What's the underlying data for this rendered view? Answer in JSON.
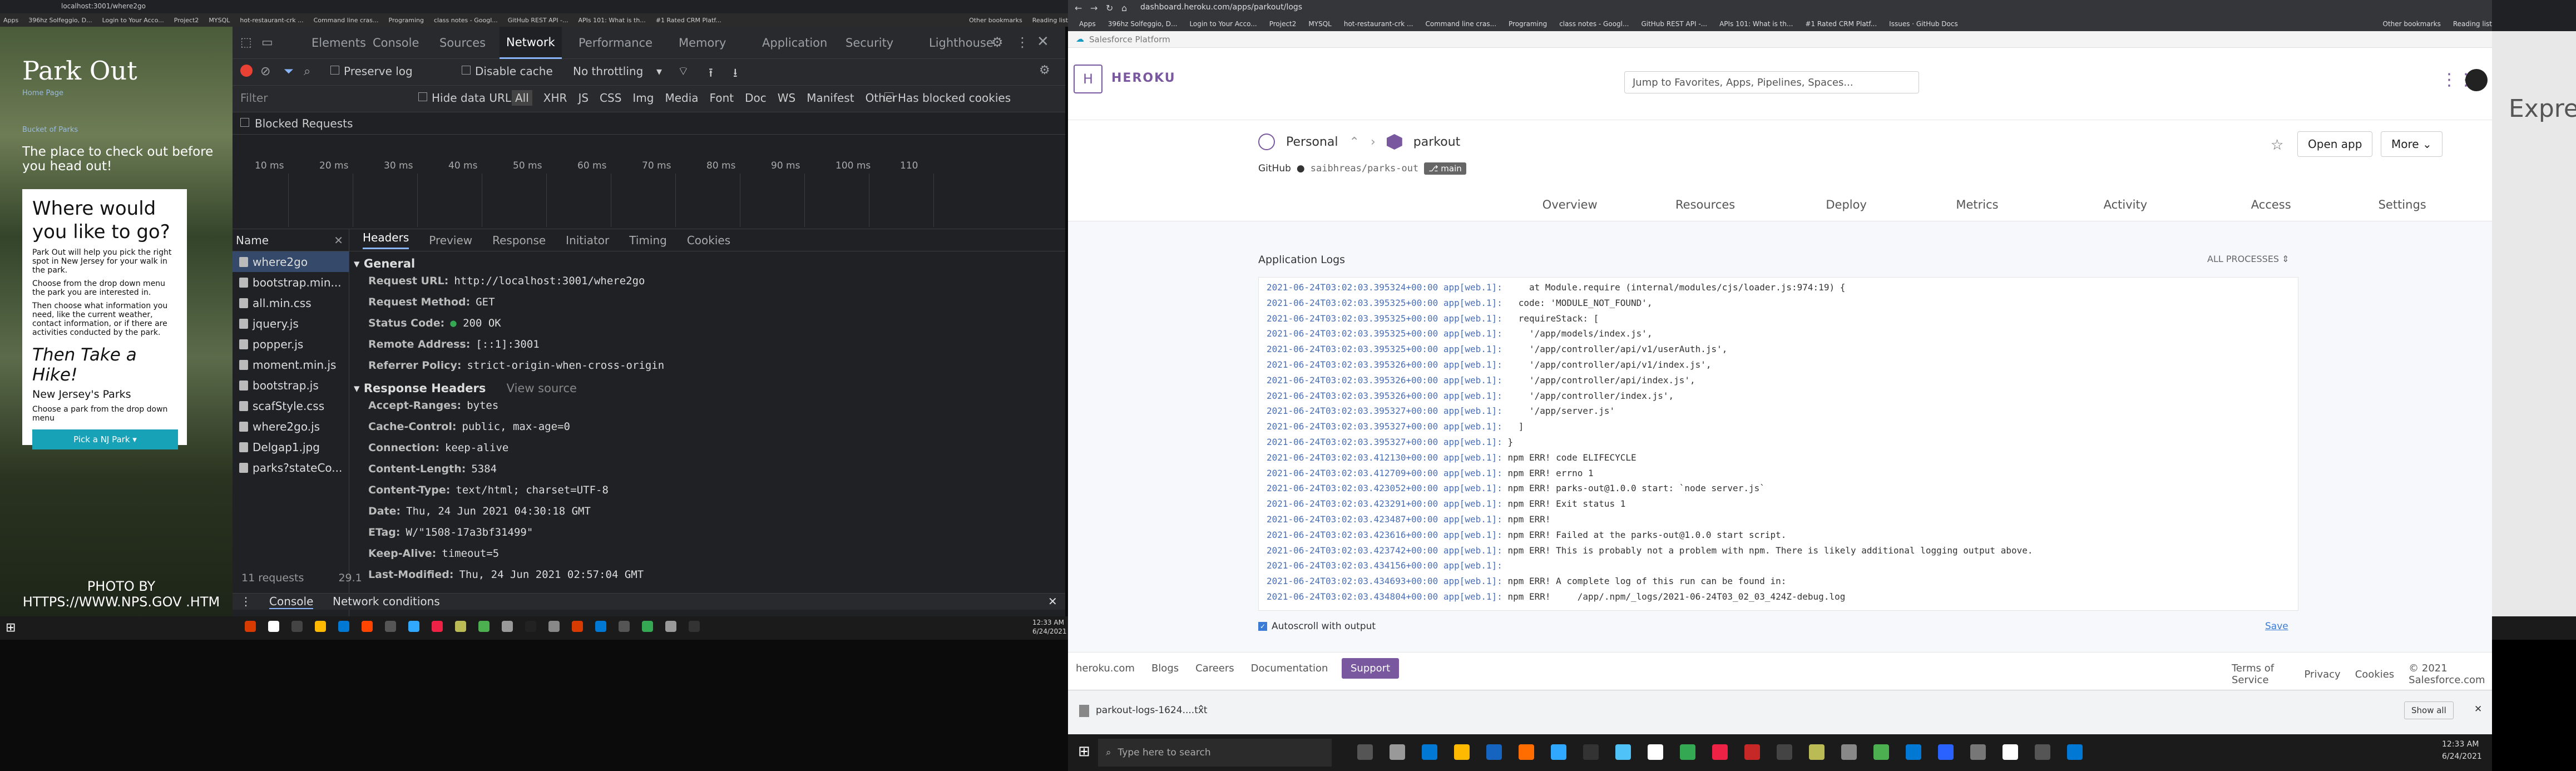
{
  "screen1": {
    "tab_url": "localhost:3001/where2go",
    "bookmarks": [
      "Apps",
      "396hz Solfeggio, D...",
      "Login to Your Acco...",
      "Project2",
      "MYSQL",
      "hot-restaurant-crk ...",
      "Command line cras...",
      "Programing",
      "class notes - Googl...",
      "GitHub REST API -...",
      "APIs 101: What is th...",
      "#1 Rated CRM Platf..."
    ],
    "bookmarks_right": [
      "Other bookmarks",
      "Reading list"
    ],
    "site": {
      "title": "Park Out",
      "link1": "Home Page",
      "link2": "Bucket of Parks",
      "tagline": "The place to check out before you head out!",
      "card_heading": "Where would you like to go?",
      "para1": "Park Out will help you pick the right spot in New Jersey for your walk in the park.",
      "para2": "Choose from the drop down menu the park you are interested in.",
      "para3": "Then choose what information you need, like the current weather, contact information, or if there are activities conducted by the park.",
      "hike": "Then Take a Hike!",
      "parks": "New Jersey's Parks",
      "choose": "Choose a park from the drop down menu",
      "button": "Pick a NJ Park",
      "photo_credit": "PHOTO BY HTTPS://WWW.NPS.GOV .HTM"
    },
    "devtools": {
      "tabs": [
        "Elements",
        "Console",
        "Sources",
        "Network",
        "Performance",
        "Memory",
        "Application",
        "Security",
        "Lighthouse"
      ],
      "active_tab": "Network",
      "preserve_log": "Preserve log",
      "disable_cache": "Disable cache",
      "throttling": "No throttling",
      "filter_placeholder": "Filter",
      "hide_data_urls": "Hide data URLs",
      "types": [
        "All",
        "XHR",
        "JS",
        "CSS",
        "Img",
        "Media",
        "Font",
        "Doc",
        "WS",
        "Manifest",
        "Other"
      ],
      "blocked_cookies": "Has blocked cookies",
      "blocked_requests": "Blocked Requests",
      "ticks": [
        "10 ms",
        "20 ms",
        "30 ms",
        "40 ms",
        "50 ms",
        "60 ms",
        "70 ms",
        "80 ms",
        "90 ms",
        "100 ms",
        "110"
      ],
      "name_header": "Name",
      "requests": [
        "where2go",
        "bootstrap.min...",
        "all.min.css",
        "jquery.js",
        "popper.js",
        "moment.min.js",
        "bootstrap.js",
        "scafStyle.css",
        "where2go.js",
        "Delgap1.jpg",
        "parks?stateCo..."
      ],
      "detail_tabs": [
        "Headers",
        "Preview",
        "Response",
        "Initiator",
        "Timing",
        "Cookies"
      ],
      "general_label": "General",
      "general": [
        {
          "k": "Request URL:",
          "v": "http://localhost:3001/where2go"
        },
        {
          "k": "Request Method:",
          "v": "GET"
        },
        {
          "k": "Status Code:",
          "v": "200 OK"
        },
        {
          "k": "Remote Address:",
          "v": "[::1]:3001"
        },
        {
          "k": "Referrer Policy:",
          "v": "strict-origin-when-cross-origin"
        }
      ],
      "response_label": "Response Headers",
      "view_source": "View source",
      "response": [
        {
          "k": "Accept-Ranges:",
          "v": "bytes"
        },
        {
          "k": "Cache-Control:",
          "v": "public, max-age=0"
        },
        {
          "k": "Connection:",
          "v": "keep-alive"
        },
        {
          "k": "Content-Length:",
          "v": "5384"
        },
        {
          "k": "Content-Type:",
          "v": "text/html; charset=UTF-8"
        },
        {
          "k": "Date:",
          "v": "Thu, 24 Jun 2021 04:30:18 GMT"
        },
        {
          "k": "ETag:",
          "v": "W/\"1508-17a3bf31499\""
        },
        {
          "k": "Keep-Alive:",
          "v": "timeout=5"
        },
        {
          "k": "Last-Modified:",
          "v": "Thu, 24 Jun 2021 02:57:04 GMT"
        }
      ],
      "req_count": "11 requests",
      "req_size": "29.1",
      "drawer_console": "Console",
      "drawer_network": "Network conditions"
    },
    "clock_time": "12:33 AM",
    "clock_date": "6/24/2021"
  },
  "screen2": {
    "url": "dashboard.heroku.com/apps/parkout/logs",
    "bookmarks": [
      "Apps",
      "396hz Solfeggio, D...",
      "Login to Your Acco...",
      "Project2",
      "MYSQL",
      "hot-restaurant-crk ...",
      "Command line cras...",
      "Programing",
      "class notes - Googl...",
      "GitHub REST API -...",
      "APIs 101: What is th...",
      "#1 Rated CRM Platf...",
      "Issues · GitHub Docs"
    ],
    "bookmarks_right": [
      "Other bookmarks",
      "Reading list"
    ],
    "salesforce": "Salesforce Platform",
    "heroku": "HEROKU",
    "search_placeholder": "Jump to Favorites, Apps, Pipelines, Spaces...",
    "crumb_personal": "Personal",
    "crumb_app": "parkout",
    "github_label": "GitHub",
    "github_repo": "saibhreas/parks-out",
    "branch": "main",
    "open_app": "Open app",
    "more": "More",
    "nav": [
      "Overview",
      "Resources",
      "Deploy",
      "Metrics",
      "Activity",
      "Access",
      "Settings"
    ],
    "logs_title": "Application Logs",
    "all_processes": "ALL PROCESSES",
    "log_lines": [
      [
        "2021-06-24T03:02:03.395324+00:00 app[web.1]:",
        "     at Module.require (internal/modules/cjs/loader.js:974:19) {"
      ],
      [
        "2021-06-24T03:02:03.395325+00:00 app[web.1]:",
        "   code: 'MODULE_NOT_FOUND',"
      ],
      [
        "2021-06-24T03:02:03.395325+00:00 app[web.1]:",
        "   requireStack: ["
      ],
      [
        "2021-06-24T03:02:03.395325+00:00 app[web.1]:",
        "     '/app/models/index.js',"
      ],
      [
        "2021-06-24T03:02:03.395325+00:00 app[web.1]:",
        "     '/app/controller/api/v1/userAuth.js',"
      ],
      [
        "2021-06-24T03:02:03.395326+00:00 app[web.1]:",
        "     '/app/controller/api/v1/index.js',"
      ],
      [
        "2021-06-24T03:02:03.395326+00:00 app[web.1]:",
        "     '/app/controller/api/index.js',"
      ],
      [
        "2021-06-24T03:02:03.395326+00:00 app[web.1]:",
        "     '/app/controller/index.js',"
      ],
      [
        "2021-06-24T03:02:03.395327+00:00 app[web.1]:",
        "     '/app/server.js'"
      ],
      [
        "2021-06-24T03:02:03.395327+00:00 app[web.1]:",
        "   ]"
      ],
      [
        "2021-06-24T03:02:03.395327+00:00 app[web.1]:",
        " }"
      ],
      [
        "2021-06-24T03:02:03.412130+00:00 app[web.1]:",
        " npm ERR! code ELIFECYCLE"
      ],
      [
        "2021-06-24T03:02:03.412709+00:00 app[web.1]:",
        " npm ERR! errno 1"
      ],
      [
        "2021-06-24T03:02:03.423052+00:00 app[web.1]:",
        " npm ERR! parks-out@1.0.0 start: `node server.js`"
      ],
      [
        "2021-06-24T03:02:03.423291+00:00 app[web.1]:",
        " npm ERR! Exit status 1"
      ],
      [
        "2021-06-24T03:02:03.423487+00:00 app[web.1]:",
        " npm ERR!"
      ],
      [
        "2021-06-24T03:02:03.423616+00:00 app[web.1]:",
        " npm ERR! Failed at the parks-out@1.0.0 start script."
      ],
      [
        "2021-06-24T03:02:03.423742+00:00 app[web.1]:",
        " npm ERR! This is probably not a problem with npm. There is likely additional logging output above."
      ],
      [
        "2021-06-24T03:02:03.434156+00:00 app[web.1]:",
        ""
      ],
      [
        "2021-06-24T03:02:03.434693+00:00 app[web.1]:",
        " npm ERR! A complete log of this run can be found in:"
      ],
      [
        "2021-06-24T03:02:03.434804+00:00 app[web.1]:",
        " npm ERR!     /app/.npm/_logs/2021-06-24T03_02_03_424Z-debug.log"
      ]
    ],
    "autoscroll": "Autoscroll with output",
    "save": "Save",
    "footer_links": [
      "heroku.com",
      "Blogs",
      "Careers",
      "Documentation"
    ],
    "support": "Support",
    "footer_right": [
      "Terms of Service",
      "Privacy",
      "Cookies",
      "© 2021 Salesforce.com"
    ],
    "download_file": "parkout-logs-1624....txt",
    "show_all": "Show all",
    "search_windows": "Type here to search",
    "clock_time": "12:33 AM",
    "clock_date": "6/24/2021"
  },
  "screen3": {
    "text": "Express"
  }
}
